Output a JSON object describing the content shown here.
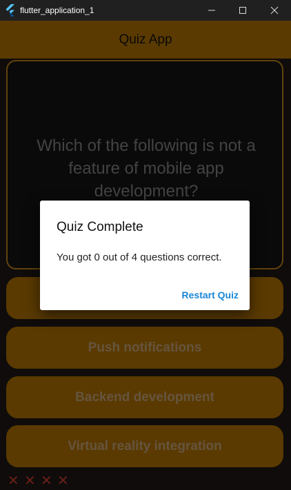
{
  "window": {
    "title": "flutter_application_1",
    "logo_icon": "flutter-logo-icon",
    "controls": [
      "minimize-icon",
      "maximize-icon",
      "close-icon"
    ]
  },
  "appbar": {
    "title": "Quiz App"
  },
  "question": {
    "text": "Which of the following is not a feature of mobile app development?"
  },
  "answers": [
    {
      "label": ""
    },
    {
      "label": "Push notifications"
    },
    {
      "label": "Backend development"
    },
    {
      "label": "Virtual reality integration"
    }
  ],
  "score_marks": [
    "✕",
    "✕",
    "✕",
    "✕"
  ],
  "dialog": {
    "title": "Quiz Complete",
    "message": "You got 0 out of 4 questions correct.",
    "action_label": "Restart Quiz"
  },
  "colors": {
    "accent": "#a56a00",
    "card_border": "#b27a18",
    "wrong_mark": "#c0392b",
    "dialog_action": "#1a86d6"
  }
}
